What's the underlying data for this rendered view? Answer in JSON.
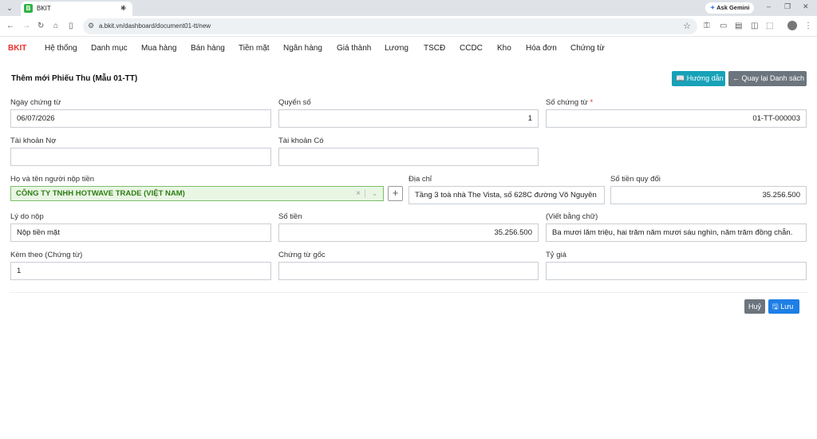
{
  "browser": {
    "tab_title": "BKIT",
    "tab_favicon": "B",
    "url": "a.bkit.vn/dashboard/document01-tt/new",
    "gemini_label": "Ask Gemini"
  },
  "app": {
    "brand": "BKIT",
    "menu": [
      "Hệ thống",
      "Danh mục",
      "Mua hàng",
      "Bán hàng",
      "Tiền mặt",
      "Ngân hàng",
      "Giá thành",
      "Lương",
      "TSCĐ",
      "CCDC",
      "Kho",
      "Hóa đơn",
      "Chứng từ"
    ]
  },
  "page": {
    "title": "Thêm mới Phiếu Thu (Mẫu 01-TT)",
    "guide_button": "Hướng dẫn",
    "back_button": "Quay lại Danh sách"
  },
  "form": {
    "ngay_chung_tu": {
      "label": "Ngày chứng từ",
      "value": "06/07/2026"
    },
    "quyen_so": {
      "label": "Quyển số",
      "value": "1"
    },
    "so_chung_tu": {
      "label": "Số chứng từ",
      "required_mark": "*",
      "value": "01-TT-000003"
    },
    "tai_khoan_no": {
      "label": "Tài khoản Nợ",
      "value": ""
    },
    "tai_khoan_co": {
      "label": "Tài khoản Có",
      "value": ""
    },
    "nguoi_nop": {
      "label": "Họ và tên người nộp tiền",
      "value": "CÔNG TY TNHH HOTWAVE TRADE (VIỆT NAM)"
    },
    "dia_chi": {
      "label": "Địa chỉ",
      "value": "Tầng 3 toà nhà The Vista, số 628C đường Võ Nguyên"
    },
    "so_tien_quy_doi": {
      "label": "Số tiền quy đổi",
      "value": "35.256.500"
    },
    "ly_do_nop": {
      "label": "Lý do nộp",
      "value": "Nộp tiền mặt"
    },
    "so_tien": {
      "label": "Số tiền",
      "value": "35.256.500"
    },
    "viet_bang_chu": {
      "label": "(Viết bằng chữ)",
      "value": "Ba mươi lăm triệu, hai trăm năm mươi sáu nghìn, năm trăm đồng chẵn."
    },
    "kem_theo": {
      "label": "Kèm theo (Chứng từ)",
      "value": "1"
    },
    "chung_tu_goc": {
      "label": "Chứng từ gốc",
      "value": ""
    },
    "ty_gia": {
      "label": "Tỷ giá",
      "value": ""
    }
  },
  "actions": {
    "cancel": "Huỷ",
    "save": "Lưu"
  },
  "colors": {
    "brand": "#e8322c",
    "guide_button": "#17a2b8",
    "secondary_button": "#6c757d",
    "save_button": "#1e7fe6",
    "selected_green": "#2e7d14"
  }
}
